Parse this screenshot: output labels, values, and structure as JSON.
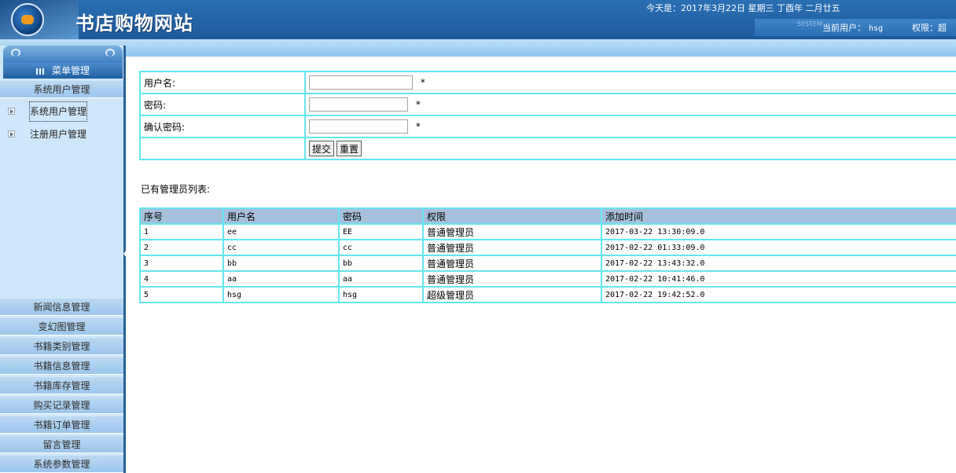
{
  "header": {
    "title": "书店购物网站",
    "date_text": "今天是：2017年3月22日 星期三 丁酉年 二月廿五",
    "system_word": "SYSTEM",
    "current_user_label": "当前用户：",
    "current_user": "hsg",
    "role_label": "权限：",
    "role_value": "超"
  },
  "menu": {
    "title": "菜单管理",
    "active_section": "系统用户管理",
    "sub_items": [
      {
        "label": "系统用户管理"
      },
      {
        "label": "注册用户管理"
      }
    ],
    "sections": [
      {
        "label": "新闻信息管理"
      },
      {
        "label": "变幻图管理"
      },
      {
        "label": "书籍类别管理"
      },
      {
        "label": "书籍信息管理"
      },
      {
        "label": "书籍库存管理"
      },
      {
        "label": "购买记录管理"
      },
      {
        "label": "书籍订单管理"
      },
      {
        "label": "留言管理"
      },
      {
        "label": "系统参数管理"
      }
    ]
  },
  "form": {
    "username_label": "用户名:",
    "password_label": "密码:",
    "confirm_label": "确认密码:",
    "required_mark": "*",
    "username_value": "",
    "password_value": "",
    "confirm_value": "",
    "submit_label": "提交",
    "reset_label": "重置"
  },
  "list": {
    "title": "已有管理员列表:",
    "columns": [
      "序号",
      "用户名",
      "密码",
      "权限",
      "添加时间"
    ],
    "rows": [
      {
        "no": "1",
        "username": "ee",
        "password": "EE",
        "role": "普通管理员",
        "time": "2017-03-22 13:30:09.0"
      },
      {
        "no": "2",
        "username": "cc",
        "password": "cc",
        "role": "普通管理员",
        "time": "2017-02-22 01:33:09.0"
      },
      {
        "no": "3",
        "username": "bb",
        "password": "bb",
        "role": "普通管理员",
        "time": "2017-02-22 13:43:32.0"
      },
      {
        "no": "4",
        "username": "aa",
        "password": "aa",
        "role": "普通管理员",
        "time": "2017-02-22 10:41:46.0"
      },
      {
        "no": "5",
        "username": "hsg",
        "password": "hsg",
        "role": "超级管理员",
        "time": "2017-02-22 19:42:52.0"
      }
    ]
  },
  "colors": {
    "header_blue": "#1d5a9c",
    "menu_bg": "#cfe7fa",
    "table_border": "#63e6ef",
    "table_header_bg": "#a8bfdc"
  }
}
